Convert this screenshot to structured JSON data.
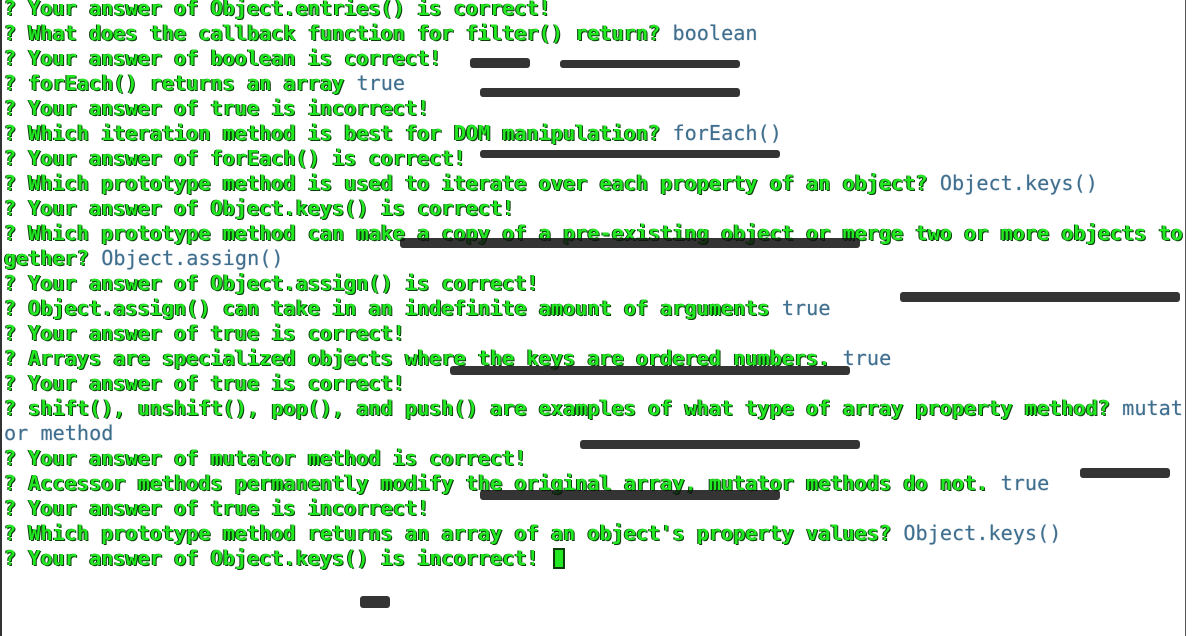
{
  "colors": {
    "prompt_text": "#22e822",
    "answer_text": "#3f6f8f",
    "background": "#ffffff"
  },
  "terminal": {
    "lines": [
      {
        "prompt": "? Your answer of Object.entries() is correct!",
        "answer": ""
      },
      {
        "prompt": "? What does the callback function for filter() return? ",
        "answer": "boolean"
      },
      {
        "prompt": "? Your answer of boolean is correct!",
        "answer": ""
      },
      {
        "prompt": "? forEach() returns an array ",
        "answer": "true"
      },
      {
        "prompt": "? Your answer of true is incorrect!",
        "answer": ""
      },
      {
        "prompt": "? Which iteration method is best for DOM manipulation? ",
        "answer": "forEach()"
      },
      {
        "prompt": "? Your answer of forEach() is correct!",
        "answer": ""
      },
      {
        "prompt": "? Which prototype method is used to iterate over each property of an object? ",
        "answer": "Object.keys()"
      },
      {
        "prompt": "? Your answer of Object.keys() is correct!",
        "answer": ""
      },
      {
        "prompt": "? Which prototype method can make a copy of a pre-existing object or merge two or more objects together? ",
        "answer": "Object.assign()"
      },
      {
        "prompt": "? Your answer of Object.assign() is correct!",
        "answer": ""
      },
      {
        "prompt": "? Object.assign() can take in an indefinite amount of arguments ",
        "answer": "true"
      },
      {
        "prompt": "? Your answer of true is correct!",
        "answer": ""
      },
      {
        "prompt": "? Arrays are specialized objects where the keys are ordered numbers. ",
        "answer": "true"
      },
      {
        "prompt": "? Your answer of true is correct!",
        "answer": ""
      },
      {
        "prompt": "? shift(), unshift(), pop(), and push() are examples of what type of array property method? ",
        "answer": "mutator method"
      },
      {
        "prompt": "? Your answer of mutator method is correct!",
        "answer": ""
      },
      {
        "prompt": "? Accessor methods permanently modify the original array, mutator methods do not. ",
        "answer": "true"
      },
      {
        "prompt": "? Your answer of true is incorrect!",
        "answer": ""
      },
      {
        "prompt": "? Which prototype method returns an array of an object's property values? ",
        "answer": "Object.keys()"
      },
      {
        "prompt": "? Your answer of Object.keys() is incorrect! ",
        "answer": "",
        "cursor": true
      }
    ]
  }
}
